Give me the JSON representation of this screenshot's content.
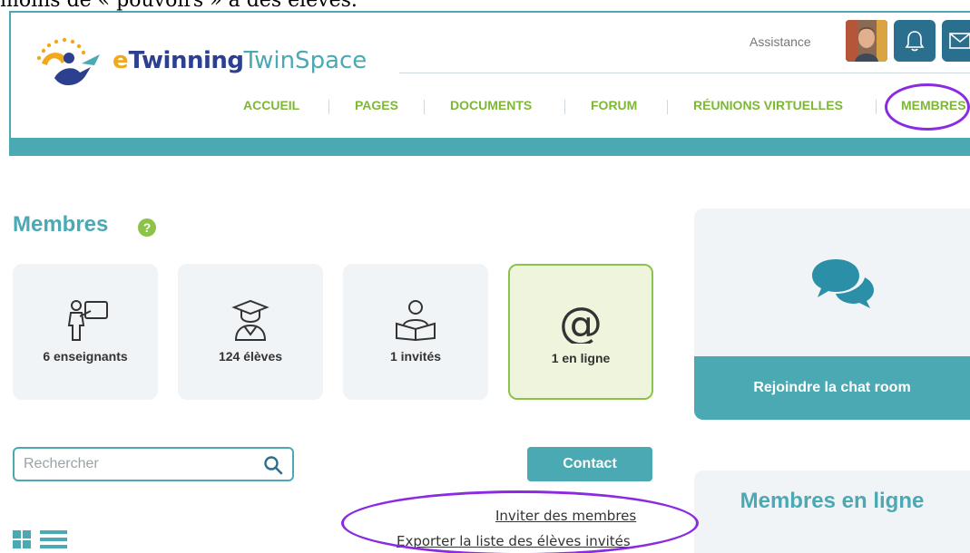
{
  "caption": "moins de « pouvoirs » à des élèves.",
  "brand": {
    "e": "e",
    "twinning": "Twinning",
    "twinspace": "TwinSpace"
  },
  "header": {
    "assistance": "Assistance"
  },
  "nav": [
    {
      "label": "ACCUEIL"
    },
    {
      "label": "PAGES"
    },
    {
      "label": "DOCUMENTS"
    },
    {
      "label": "FORUM"
    },
    {
      "label": "RÉUNIONS VIRTUELLES"
    },
    {
      "label": "MEMBRES"
    }
  ],
  "page": {
    "title": "Membres",
    "help": "?"
  },
  "stats": [
    {
      "label": "6 enseignants",
      "icon": "teacher-icon"
    },
    {
      "label": "124 élèves",
      "icon": "student-icon"
    },
    {
      "label": "1 invités",
      "icon": "reader-icon"
    },
    {
      "label": "1 en ligne",
      "icon": "at-icon"
    }
  ],
  "search": {
    "placeholder": "Rechercher"
  },
  "contact": {
    "label": "Contact"
  },
  "links": {
    "invite": "Inviter des membres",
    "export": "Exporter la liste des élèves invités"
  },
  "chat": {
    "cta": "Rejoindre la chat room"
  },
  "online": {
    "title": "Membres en ligne"
  },
  "colors": {
    "teal": "#4aa9b3",
    "green": "#7db735",
    "navy": "#2d3f8f",
    "annotation": "#8a2be2"
  }
}
